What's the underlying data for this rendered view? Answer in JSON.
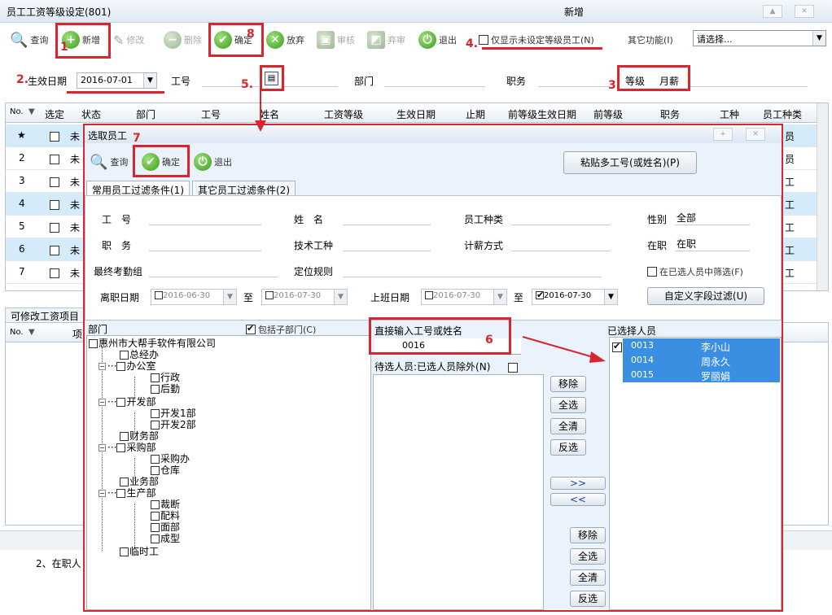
{
  "window": {
    "title": "员工工资等级设定(801)",
    "mode": "新增"
  },
  "toolbar": {
    "query": "查询",
    "add": "新增",
    "edit": "修改",
    "delete": "删除",
    "confirm": "确定",
    "discard": "放弃",
    "audit": "审核",
    "unaudit": "弃审",
    "exit": "退出",
    "only_unset_label": "仅显示未设定等级员工(N)",
    "other_func_label": "其它功能(I)",
    "other_func_value": "请选择..."
  },
  "form": {
    "effective_date_label": "生效日期",
    "effective_date": "2016-07-01",
    "empno_label": "工号",
    "dept_label": "部门",
    "job_label": "职务",
    "grade_label": "等级",
    "grade_value": "月薪"
  },
  "grid": {
    "columns": [
      "No.",
      "选定",
      "状态",
      "部门",
      "工号",
      "姓名",
      "工资等级",
      "生效日期",
      "止期",
      "前等级生效日期",
      "前等级",
      "职务",
      "工种",
      "员工种类"
    ],
    "rows": [
      {
        "no": "★",
        "status": "未",
        "type": "员"
      },
      {
        "no": "2",
        "status": "未",
        "type": "员"
      },
      {
        "no": "3",
        "status": "未",
        "type": "工"
      },
      {
        "no": "4",
        "status": "未",
        "type": "工"
      },
      {
        "no": "5",
        "status": "未",
        "type": "工"
      },
      {
        "no": "6",
        "status": "未",
        "type": "工"
      },
      {
        "no": "7",
        "status": "未",
        "type": "工"
      }
    ]
  },
  "lower": {
    "tab_label": "可修改工资项目",
    "no": "No.",
    "col": "项",
    "note": "2、在职人"
  },
  "annotations": [
    "1",
    "2.",
    "3.",
    "4.",
    "5.",
    "6",
    "7",
    "8"
  ],
  "dialog": {
    "title": "选取员工",
    "query": "查询",
    "confirm": "确定",
    "exit": "退出",
    "paste_button": "粘贴多工号(或姓名)(P)",
    "tab1": "常用员工过滤条件(1)",
    "tab2": "其它员工过滤条件(2)",
    "filters": {
      "empno": "工　号",
      "name": "姓　名",
      "emptype": "员工种类",
      "gender_label": "性别",
      "gender_value": "全部",
      "job": "职　务",
      "tech": "技术工种",
      "pay": "计薪方式",
      "onjob_label": "在职",
      "onjob_value": "在职",
      "attgroup": "最终考勤组",
      "locrule": "定位规则",
      "in_selected": "在已选人员中筛选(F)",
      "leave_date": "离职日期",
      "leave_from": "2016-06-30",
      "to1": "至",
      "leave_to": "2016-07-30",
      "work_date": "上班日期",
      "work_from": "2016-07-30",
      "to2": "至",
      "work_to": "2016-07-30",
      "custom_filter": "自定义字段过滤(U)"
    },
    "dept_label": "部门",
    "include_sub": "包括子部门(C)",
    "tree": {
      "root": "惠州市大帮手软件有限公司",
      "n1": "总经办",
      "n2": "办公室",
      "n2a": "行政",
      "n2b": "后勤",
      "n3": "开发部",
      "n3a": "开发1部",
      "n3b": "开发2部",
      "n4": "财务部",
      "n5": "采购部",
      "n5a": "采购办",
      "n5b": "仓库",
      "n6": "业务部",
      "n7": "生产部",
      "n7a": "裁断",
      "n7b": "配料",
      "n7c": "面部",
      "n7d": "成型",
      "n8": "临时工"
    },
    "direct_label": "直接输入工号或姓名",
    "direct_value": "0016",
    "pending_label": "待选人员:已选人员除外(N)",
    "btn_remove": "移除",
    "btn_all": "全选",
    "btn_clear": "全清",
    "btn_invert": "反选",
    "btn_add": ">>",
    "btn_back": "<<",
    "selected_label": "已选择人员",
    "selected": [
      {
        "id": "0013",
        "name": "李小山"
      },
      {
        "id": "0014",
        "name": "周永久"
      },
      {
        "id": "0015",
        "name": "罗丽娟"
      }
    ]
  }
}
